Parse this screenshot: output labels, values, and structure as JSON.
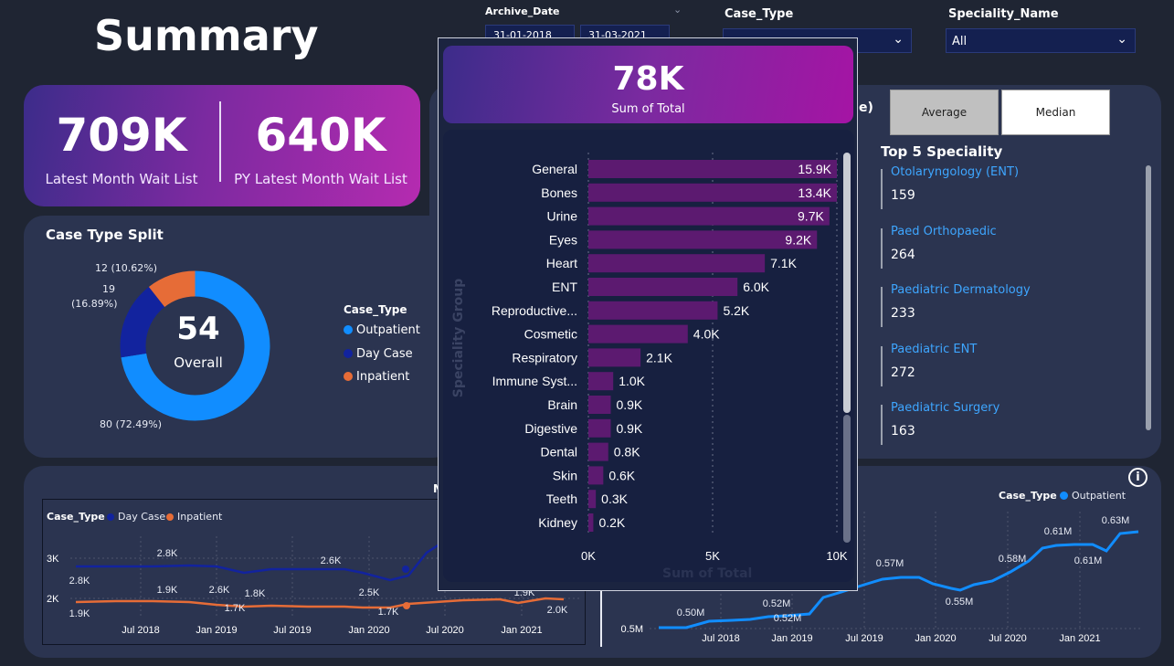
{
  "page": {
    "title": "Summary"
  },
  "filters": {
    "archive_date": {
      "label": "Archive_Date",
      "from": "31-01-2018",
      "to": "31-03-2021"
    },
    "case_type": {
      "label": "Case_Type",
      "value": ""
    },
    "speciality": {
      "label": "Speciality_Name",
      "value": "All"
    }
  },
  "kpis": {
    "latest": {
      "value": "709K",
      "label": "Latest Month Wait List"
    },
    "py_latest": {
      "value": "640K",
      "label": "PY Latest Month Wait List"
    }
  },
  "case_split": {
    "title": "Case Type Split",
    "center_value": "54",
    "center_label": "Overall",
    "legend_title": "Case_Type",
    "slices": [
      {
        "name": "Outpatient",
        "value": 80,
        "label": "80 (72.49%)",
        "color": "#118dff"
      },
      {
        "name": "Day Case",
        "value": 19,
        "label_line1": "19",
        "label_line2": "(16.89%)",
        "color": "#12239e"
      },
      {
        "name": "Inpatient",
        "value": 12,
        "label": "12 (10.62%)",
        "color": "#e66c37"
      }
    ]
  },
  "right_panel": {
    "heading_fragment": "ge)",
    "buttons": {
      "average": "Average",
      "median": "Median"
    },
    "top5_title": "Top 5 Speciality",
    "specialities": [
      {
        "name": "Otolaryngology (ENT)",
        "value": "159"
      },
      {
        "name": "Paed Orthopaedic",
        "value": "264"
      },
      {
        "name": "Paediatric Dermatology",
        "value": "233"
      },
      {
        "name": "Paediatric ENT",
        "value": "272"
      },
      {
        "name": "Paediatric Surgery",
        "value": "163"
      }
    ]
  },
  "popup": {
    "kpi_value": "78K",
    "kpi_label": "Sum of Total",
    "axis_label": "Sum of Total",
    "y_axis_label": "Speciality Group"
  },
  "left_trend": {
    "legend_title": "Case_Type",
    "legend_items": [
      {
        "name": "Day Case",
        "color": "#12239e"
      },
      {
        "name": "Inpatient",
        "color": "#e66c37"
      }
    ],
    "title_fragment": "M",
    "y_ticks": [
      "3K",
      "2K"
    ],
    "x_ticks": [
      "Jul 2018",
      "Jan 2019",
      "Jul 2019",
      "Jan 2020",
      "Jul 2020",
      "Jan 2021"
    ],
    "day_case_labels": [
      "2.8K",
      "2.8K",
      "2.6K",
      "2.6K",
      "2.5K",
      "1.9K"
    ],
    "inpatient_labels": [
      "1.9K",
      "1.9K",
      "1.8K",
      "1.7K",
      "1.7K",
      "2.0K"
    ]
  },
  "right_trend": {
    "legend_title": "Case_Type",
    "legend_item": {
      "name": "Outpatient",
      "color": "#118dff"
    },
    "y_tick": "0.5M",
    "x_ticks": [
      "Jul 2018",
      "Jan 2019",
      "Jul 2019",
      "Jan 2020",
      "Jul 2020",
      "Jan 2021"
    ],
    "labels": [
      "0.50M",
      "0.52M",
      "0.52M",
      "0.57M",
      "0.55M",
      "0.58M",
      "0.61M",
      "0.61M",
      "0.63M"
    ]
  },
  "chart_data": [
    {
      "type": "bar",
      "orientation": "horizontal",
      "categories": [
        "General",
        "Bones",
        "Urine",
        "Eyes",
        "Heart",
        "ENT",
        "Reproductive...",
        "Cosmetic",
        "Respiratory",
        "Immune Syst...",
        "Brain",
        "Digestive",
        "Dental",
        "Skin",
        "Teeth",
        "Kidney"
      ],
      "values": [
        15900,
        13400,
        9700,
        9200,
        7100,
        6000,
        5200,
        4000,
        2100,
        1000,
        900,
        900,
        800,
        600,
        300,
        200
      ],
      "labels": [
        "15.9K",
        "13.4K",
        "9.7K",
        "9.2K",
        "7.1K",
        "6.0K",
        "5.2K",
        "4.0K",
        "2.1K",
        "1.0K",
        "0.9K",
        "0.9K",
        "0.8K",
        "0.6K",
        "0.3K",
        "0.2K"
      ],
      "xlim": [
        0,
        10000
      ],
      "x_ticks": [
        "0K",
        "5K",
        "10K"
      ],
      "xlabel": "Sum of Total",
      "ylabel": "Speciality Group",
      "bar_color": "#5c1a70"
    },
    {
      "type": "pie",
      "categories": [
        "Outpatient",
        "Day Case",
        "Inpatient"
      ],
      "values": [
        80,
        19,
        12
      ],
      "percent": [
        72.49,
        16.89,
        10.62
      ]
    }
  ]
}
